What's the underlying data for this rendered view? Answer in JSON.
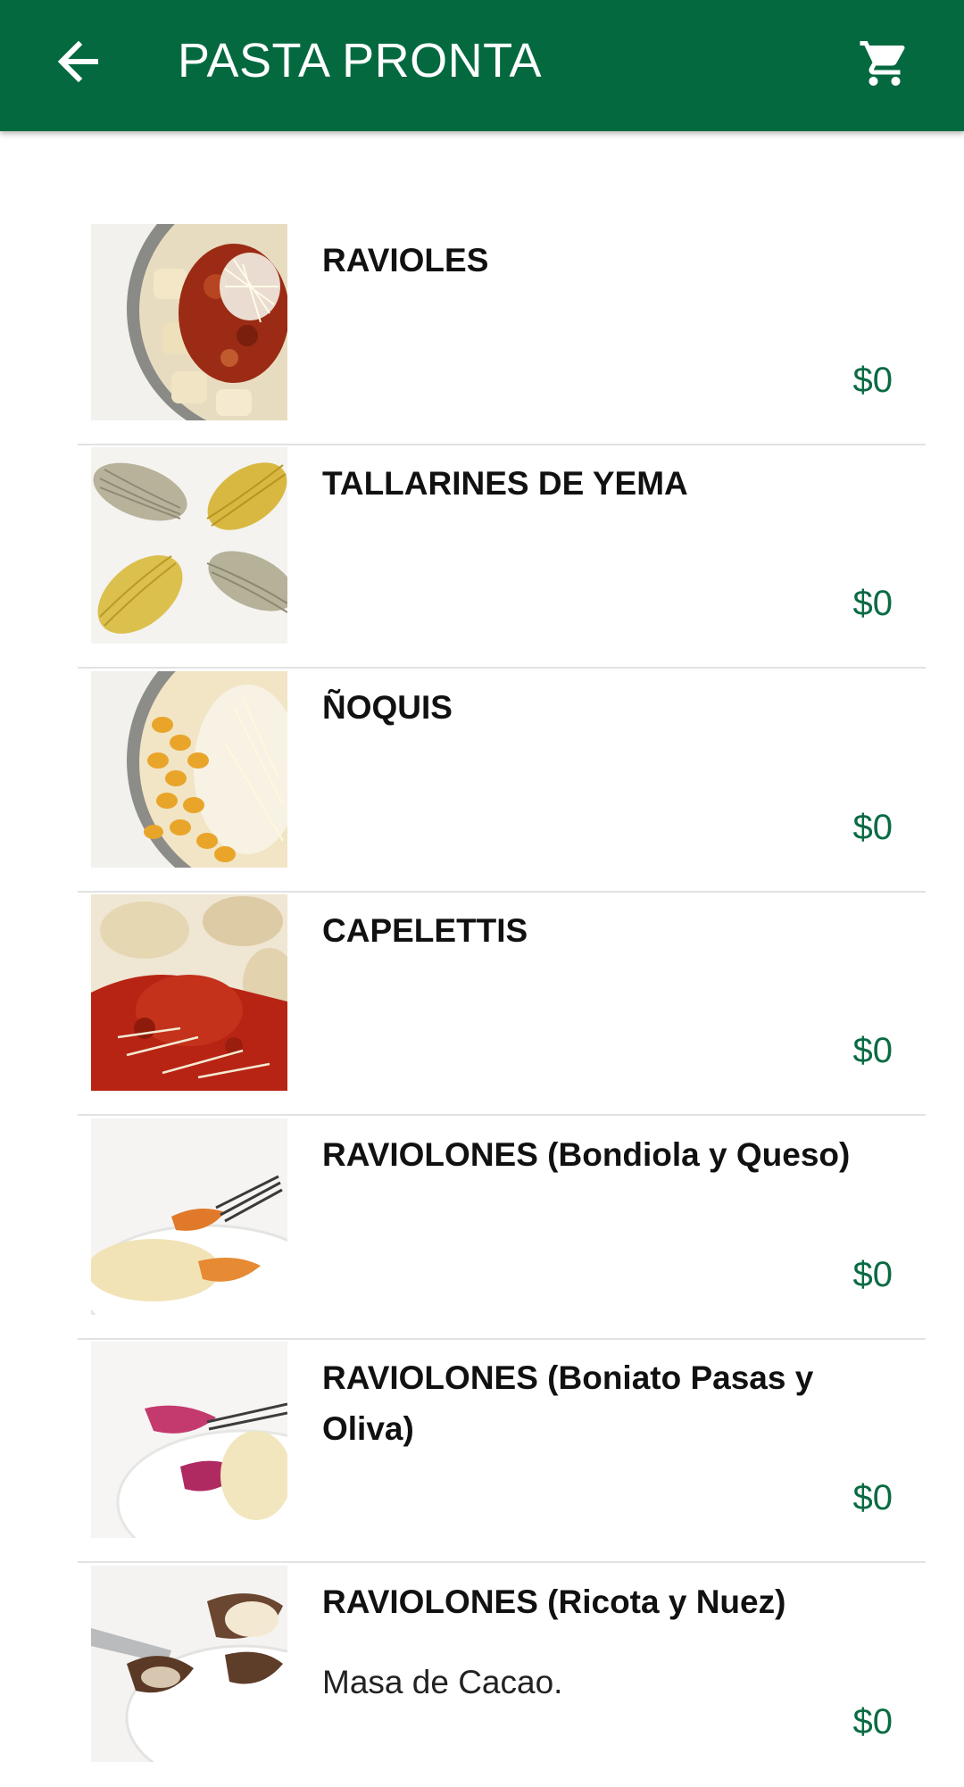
{
  "appbar": {
    "title": "PASTA PRONTA",
    "back_icon": "arrow-left-icon",
    "cart_icon": "shopping-cart-icon",
    "color": "#04693f"
  },
  "products": [
    {
      "name": "RAVIOLES",
      "desc": "",
      "price": "$0"
    },
    {
      "name": "TALLARINES DE YEMA",
      "desc": "",
      "price": "$0"
    },
    {
      "name": "ÑOQUIS",
      "desc": "",
      "price": "$0"
    },
    {
      "name": "CAPELETTIS",
      "desc": "",
      "price": "$0"
    },
    {
      "name": "RAVIOLONES (Bondiola y Queso)",
      "desc": "",
      "price": "$0"
    },
    {
      "name": "RAVIOLONES (Boniato Pasas y Oliva)",
      "desc": "",
      "price": "$0"
    },
    {
      "name": "RAVIOLONES (Ricota y Nuez)",
      "desc": "Masa de Cacao.",
      "price": "$0"
    }
  ],
  "colors": {
    "price": "#0b6b43",
    "divider": "#e2e2e2"
  }
}
